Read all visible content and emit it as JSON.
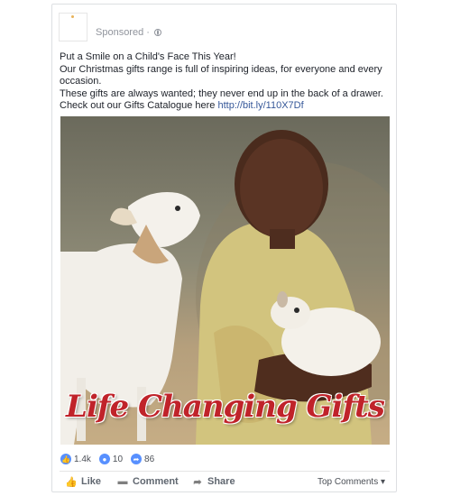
{
  "post": {
    "sponsored_label": "Sponsored",
    "separator": "·",
    "text_lines": [
      "Put a Smile on a Child's Face This Year!",
      "Our Christmas gifts range is full of inspiring ideas, for everyone and every occasion.",
      "These gifts are always wanted; they never end up in the back of a drawer. Check out our Gifts Catalogue here "
    ],
    "link": "http://bit.ly/110X7Df",
    "image_caption": "Life Changing Gifts"
  },
  "stats": {
    "likes": "1.4k",
    "comments": "10",
    "shares": "86"
  },
  "actions": {
    "like": "Like",
    "comment": "Comment",
    "share": "Share",
    "top_comments": "Top Comments ▾"
  },
  "icons": {
    "like": "thumbs-up-icon",
    "comment": "speech-bubble-icon",
    "share": "share-arrow-icon",
    "globe": "globe-icon"
  },
  "colors": {
    "link": "#365899",
    "reaction_blue": "#5890ff",
    "caption_red": "#c0232a"
  }
}
